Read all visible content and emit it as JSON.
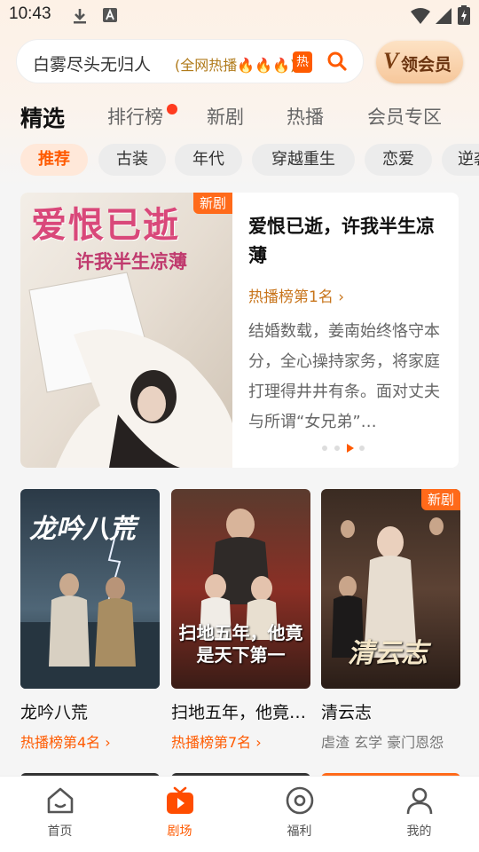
{
  "status_bar": {
    "time": "10:43"
  },
  "search": {
    "query": "白雾尽头无归人",
    "hot_text": "(全网热播🔥🔥🔥)",
    "hot_badge": "热"
  },
  "vip_button": {
    "v": "V",
    "label": "领会员"
  },
  "main_tabs": [
    {
      "label": "精选",
      "active": true
    },
    {
      "label": "排行榜",
      "dot": true
    },
    {
      "label": "新剧"
    },
    {
      "label": "热播"
    },
    {
      "label": "会员专区"
    }
  ],
  "chips": [
    {
      "label": "推荐",
      "active": true
    },
    {
      "label": "古装"
    },
    {
      "label": "年代"
    },
    {
      "label": "穿越重生"
    },
    {
      "label": "恋爱"
    },
    {
      "label": "逆袭"
    }
  ],
  "featured": {
    "badge": "新剧",
    "poster_title": "爱恨已逝",
    "poster_subtitle": "许我半生凉薄",
    "title": "爱恨已逝，许我半生凉薄",
    "rank": "热播榜第1名 ›",
    "description": "结婚数载，姜南始终恪守本分，全心操持家务，将家庭打理得井井有条。面对丈夫与所谓“女兄弟”…",
    "active_dot": 2
  },
  "cards": [
    {
      "title": "龙吟八荒",
      "meta": "热播榜第4名 ›",
      "poster_text": "龙吟八荒",
      "badge": ""
    },
    {
      "title": "扫地五年，他竟…",
      "meta": "热播榜第7名 ›",
      "poster_text": "扫地五年，他竟是天下第一",
      "badge": ""
    },
    {
      "title": "清云志",
      "meta": "虐渣  玄学  豪门恩怨",
      "poster_text": "清云志",
      "badge": "新剧"
    }
  ],
  "bottom_nav": [
    {
      "label": "首页",
      "icon": "home-icon"
    },
    {
      "label": "剧场",
      "icon": "theater-icon",
      "active": true
    },
    {
      "label": "福利",
      "icon": "welfare-icon"
    },
    {
      "label": "我的",
      "icon": "profile-icon"
    }
  ],
  "colors": {
    "accent": "#ff5a00",
    "rank": "#c8751c",
    "vip_text": "#6b3410"
  }
}
